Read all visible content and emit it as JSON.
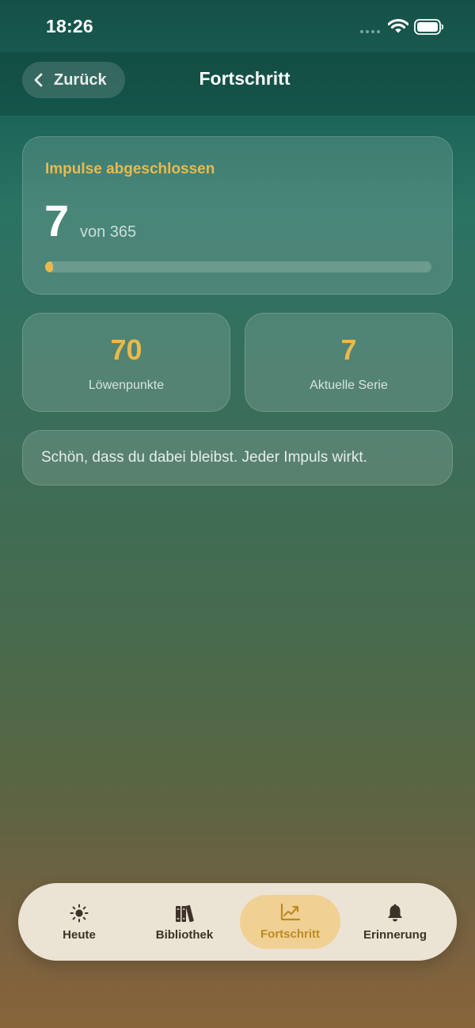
{
  "status_bar": {
    "time": "18:26"
  },
  "header": {
    "back_label": "Zurück",
    "title": "Fortschritt"
  },
  "progress": {
    "heading": "Impulse abgeschlossen",
    "completed": "7",
    "total_text": "von 365",
    "fraction": 0.019
  },
  "stats": {
    "points_value": "70",
    "points_label": "Löwenpunkte",
    "streak_value": "7",
    "streak_label": "Aktuelle Serie"
  },
  "message": "Schön, dass du dabei bleibst. Jeder Impuls wirkt.",
  "tabs": [
    {
      "label": "Heute",
      "icon": "sun-icon",
      "active": false
    },
    {
      "label": "Bibliothek",
      "icon": "books-icon",
      "active": false
    },
    {
      "label": "Fortschritt",
      "icon": "chart-trend-icon",
      "active": true
    },
    {
      "label": "Erinnerung",
      "icon": "bell-icon",
      "active": false
    }
  ],
  "colors": {
    "accent": "#e8ba4e",
    "active_tab_background": "#f0d193",
    "tab_bar_background": "#ebe3d4"
  }
}
